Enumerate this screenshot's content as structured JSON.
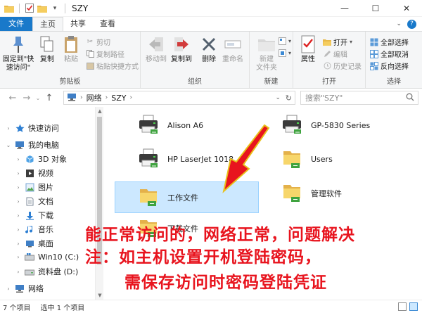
{
  "window": {
    "title": "SZY",
    "minimize": "—",
    "maximize": "☐",
    "close": "✕"
  },
  "tabs": {
    "file": "文件",
    "home": "主页",
    "share": "共享",
    "view": "查看"
  },
  "ribbon": {
    "clipboard": {
      "label": "剪贴板",
      "pin": "固定到\"快速访问\"",
      "copy": "复制",
      "paste": "粘贴",
      "cut": "剪切",
      "copy_path": "复制路径",
      "paste_shortcut": "粘贴快捷方式"
    },
    "organize": {
      "label": "组织",
      "move_to": "移动到",
      "copy_to": "复制到",
      "delete": "删除",
      "rename": "重命名"
    },
    "new": {
      "label": "新建",
      "new_folder": "新建\n文件夹"
    },
    "open": {
      "label": "打开",
      "properties": "属性",
      "open": "打开",
      "edit": "编辑",
      "history": "历史记录"
    },
    "select": {
      "label": "选择",
      "select_all": "全部选择",
      "select_none": "全部取消",
      "invert": "反向选择"
    }
  },
  "address": {
    "segments": [
      "网络",
      "SZY"
    ],
    "search_placeholder": "搜索\"SZY\""
  },
  "nav": {
    "quick_access": "快速访问",
    "this_pc": "我的电脑",
    "items": [
      "3D 对象",
      "视频",
      "图片",
      "文档",
      "下载",
      "音乐",
      "桌面",
      "Win10 (C:)",
      "资料盘 (D:)"
    ],
    "network": "网络"
  },
  "content": {
    "items": [
      {
        "name": "Alison A6",
        "kind": "printer"
      },
      {
        "name": "GP-5830 Series",
        "kind": "printer"
      },
      {
        "name": "HP LaserJet 1018",
        "kind": "printer"
      },
      {
        "name": "Users",
        "kind": "folder"
      },
      {
        "name": "工作文件",
        "kind": "folder",
        "selected": true
      },
      {
        "name": "管理软件",
        "kind": "folder"
      },
      {
        "name": "下载文件",
        "kind": "folder"
      }
    ]
  },
  "status": {
    "count": "7 个项目",
    "selected": "选中 1 个项目"
  },
  "annotation": {
    "line1": "能正常访问的，网络正常，问题解决",
    "line2": "注：如主机设置开机登陆密码，",
    "line3": "需保存访问时密码登陆凭证"
  },
  "colors": {
    "accent": "#1979ca",
    "selection": "#cce8ff",
    "annotation": "#e8141e"
  }
}
